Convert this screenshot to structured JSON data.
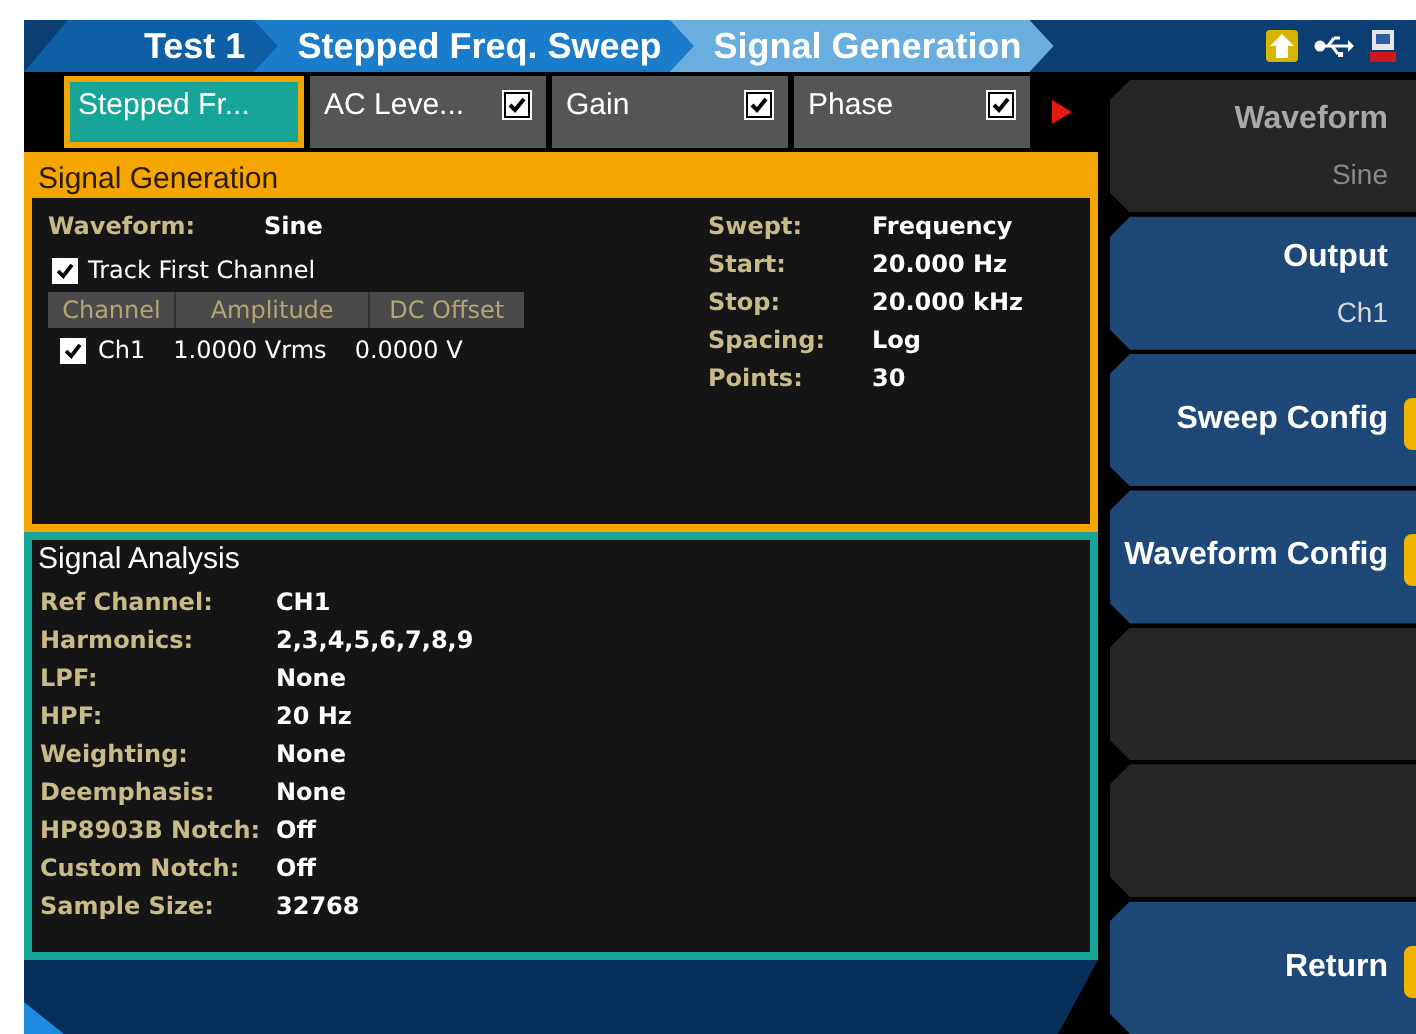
{
  "breadcrumb": [
    "Test 1",
    "Stepped Freq. Sweep",
    "Signal Generation"
  ],
  "tabs": [
    {
      "kind": "plain",
      "label": "Stepped Fr...",
      "selected": true
    },
    {
      "kind": "check",
      "label": "AC Leve...",
      "selected": false,
      "checked": true
    },
    {
      "kind": "check",
      "label": "Gain",
      "selected": false,
      "checked": true
    },
    {
      "kind": "check",
      "label": "Phase",
      "selected": false,
      "checked": true
    }
  ],
  "signal_generation": {
    "title": "Signal Generation",
    "focused": true,
    "fields_left": [
      {
        "label": "Waveform:",
        "value": "Sine"
      }
    ],
    "track": {
      "label": "Track First Channel",
      "checked": true
    },
    "channel_table": {
      "columns": [
        "Channel",
        "Amplitude",
        "DC Offset"
      ],
      "rows": [
        {
          "checked": true,
          "cells": [
            "Ch1",
            "1.0000 Vrms",
            "0.0000 V"
          ]
        }
      ]
    },
    "fields_right": [
      {
        "label": "Swept:",
        "value": "Frequency"
      },
      {
        "label": "Start:",
        "value": "20.000 Hz"
      },
      {
        "label": "Stop:",
        "value": "20.000 kHz"
      },
      {
        "label": "Spacing:",
        "value": "Log"
      },
      {
        "label": "Points:",
        "value": "30"
      }
    ]
  },
  "signal_analysis": {
    "title": "Signal Analysis",
    "focused": false,
    "fields": [
      {
        "label": "Ref Channel:",
        "value": "CH1"
      },
      {
        "label": "Harmonics:",
        "value": "2,3,4,5,6,7,8,9"
      },
      {
        "label": "LPF:",
        "value": "None"
      },
      {
        "label": "HPF:",
        "value": "20 Hz"
      },
      {
        "label": "Weighting:",
        "value": "None"
      },
      {
        "label": "Deemphasis:",
        "value": "None"
      },
      {
        "label": "HP8903B Notch:",
        "value": "Off"
      },
      {
        "label": "Custom Notch:",
        "value": "Off"
      },
      {
        "label": "Sample Size:",
        "value": "32768"
      }
    ]
  },
  "softkeys": [
    {
      "kind": "labeled",
      "label": "Waveform",
      "value": "Sine",
      "disabled": true,
      "submenu": false
    },
    {
      "kind": "labeled",
      "label": "Output",
      "value": "Ch1",
      "disabled": false,
      "submenu": false
    },
    {
      "kind": "labeled",
      "label": "Sweep Config",
      "disabled": false,
      "submenu": true
    },
    {
      "kind": "labeled",
      "label": "Waveform Config",
      "disabled": false,
      "submenu": true
    },
    {
      "kind": "blank"
    },
    {
      "kind": "blank"
    },
    {
      "kind": "labeled",
      "label": "Return",
      "disabled": false,
      "submenu": true
    }
  ]
}
